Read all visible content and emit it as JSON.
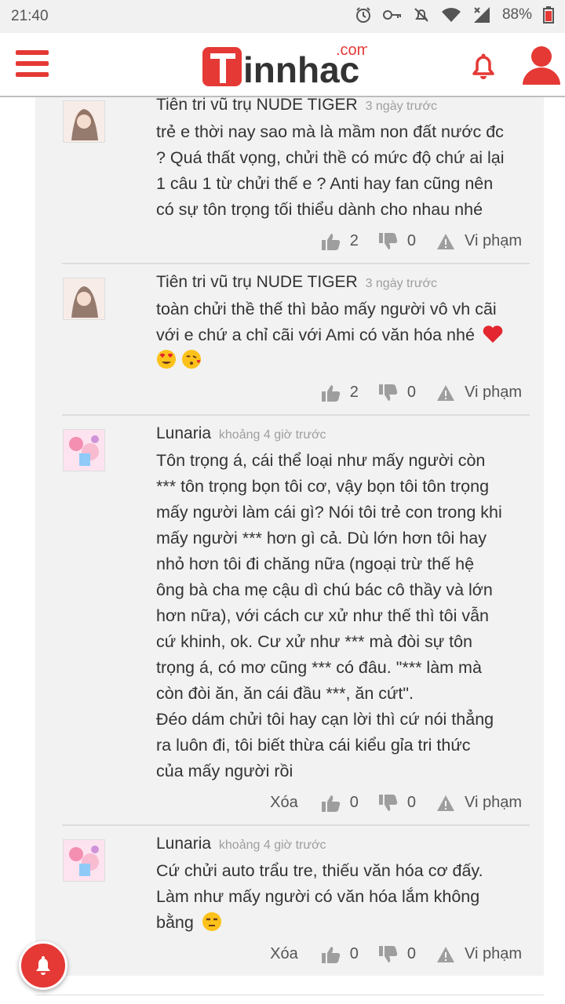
{
  "status_bar": {
    "time": "21:40",
    "battery": "88%"
  },
  "header": {
    "logo_com": ".com",
    "logo_text": "innhac"
  },
  "comments": [
    {
      "author": "Tiên tri vũ trụ NUDE TIGER",
      "time": "3 ngày trước",
      "lines": [
        "trẻ e thời nay sao mà là mầm non đất nước đc",
        "? Quá thất vọng, chửi thề có mức độ chứ ai lại",
        "1 câu 1 từ chửi thế e ? Anti hay fan cũng nên",
        "có sự tôn trọng tối thiểu dành cho nhau nhé"
      ],
      "likes": "2",
      "dislikes": "0",
      "report": "Vi phạm"
    },
    {
      "author": "Tiên tri vũ trụ NUDE TIGER",
      "time": "3 ngày trước",
      "lines": [
        "toàn chửi thề thế thì bảo mấy người vô vh cãi",
        "với e chứ a chỉ cãi với Ami có văn hóa nhé"
      ],
      "likes": "2",
      "dislikes": "0",
      "report": "Vi phạm"
    },
    {
      "author": "Lunaria",
      "time": "khoảng 4 giờ trước",
      "lines": [
        "Tôn trọng á, cái thể loại như mấy người còn",
        "*** tôn trọng bọn tôi cơ, vậy bọn tôi tôn trọng",
        "mấy người làm cái gì? Nói tôi trẻ con trong khi",
        "mấy người *** hơn gì cả. Dù lớn hơn tôi hay",
        "nhỏ hơn tôi đi chăng nữa (ngoại trừ thế hệ",
        "ông bà cha mẹ cậu dì chú bác cô thầy và lớn",
        "hơn nữa), với cách cư xử như thế thì tôi vẫn",
        "cứ khinh, ok. Cư xử như *** mà đòi sự tôn",
        "trọng á, có mơ cũng *** có đâu. \"*** làm mà",
        "còn đòi ăn, ăn cái đầu ***, ăn cứt\".",
        "Đéo dám chửi tôi hay cạn lời thì cứ nói thẳng",
        "ra luôn đi, tôi biết thừa cái kiểu gỉa tri thức",
        "của mấy người rồi"
      ],
      "delete": "Xóa",
      "likes": "0",
      "dislikes": "0",
      "report": "Vi phạm"
    },
    {
      "author": "Lunaria",
      "time": "khoảng 4 giờ trước",
      "lines": [
        "Cứ chửi auto trẩu tre, thiếu văn hóa cơ đấy.",
        "Làm như mấy người có văn hóa lắm không",
        "bằng"
      ],
      "delete": "Xóa",
      "likes": "0",
      "dislikes": "0",
      "report": "Vi phạm"
    }
  ],
  "colors": {
    "brand_red": "#e53935",
    "content_bg": "#f2f2f2",
    "icon_gray": "#9e9e9e"
  },
  "icons": [
    "menu-icon",
    "bell-icon",
    "user-icon",
    "thumbs-up-icon",
    "thumbs-down-icon",
    "warning-icon",
    "heart-emoji",
    "smile-emoji"
  ]
}
